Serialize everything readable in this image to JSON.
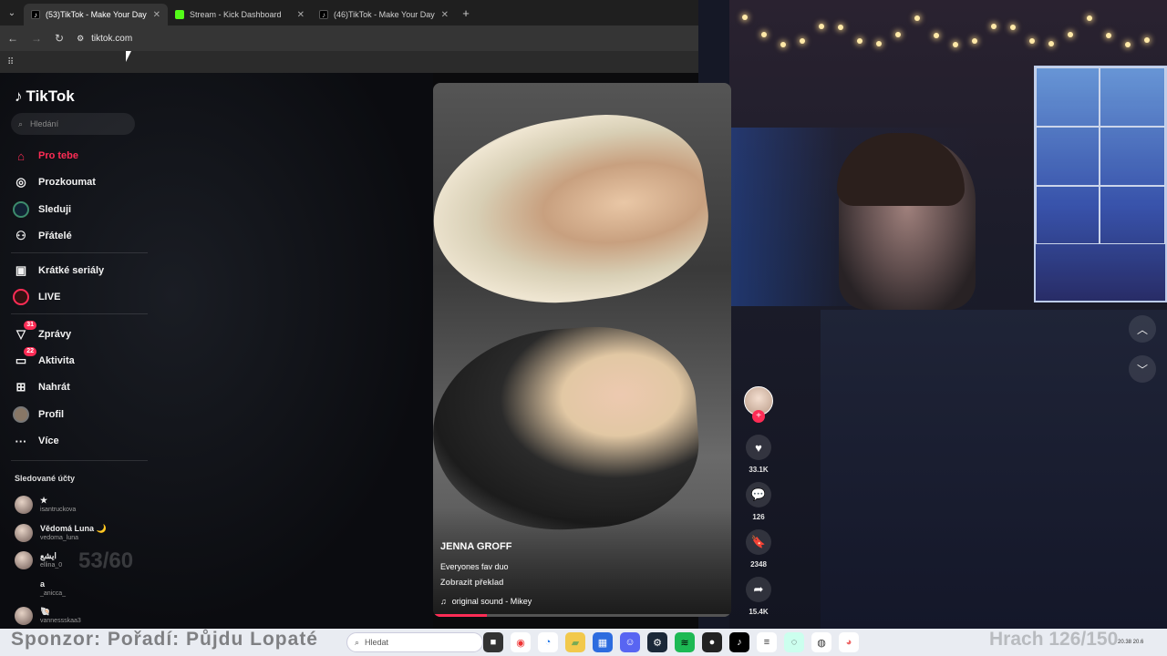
{
  "browser": {
    "tabs": [
      {
        "title": "(53)TikTok - Make Your Day",
        "active": true,
        "favicon": "tiktok-icon"
      },
      {
        "title": "Stream - Kick Dashboard",
        "active": false,
        "favicon": "kick-icon"
      },
      {
        "title": "(46)TikTok - Make Your Day",
        "active": false,
        "favicon": "tiktok-icon"
      }
    ],
    "url": "tiktok.com"
  },
  "sidebar": {
    "logo": "TikTok",
    "search_placeholder": "Hledání",
    "nav": [
      {
        "label": "Pro tebe",
        "icon": "home-icon",
        "active": true
      },
      {
        "label": "Prozkoumat",
        "icon": "compass-icon"
      },
      {
        "label": "Sleduji",
        "icon": "following-icon"
      },
      {
        "label": "Přátelé",
        "icon": "friends-icon"
      },
      {
        "label": "Krátké seriály",
        "icon": "series-icon"
      },
      {
        "label": "LIVE",
        "icon": "live-icon"
      },
      {
        "label": "Zprávy",
        "icon": "messages-icon",
        "badge": "31"
      },
      {
        "label": "Aktivita",
        "icon": "activity-icon",
        "badge": "22"
      },
      {
        "label": "Nahrát",
        "icon": "upload-icon"
      },
      {
        "label": "Profil",
        "icon": "profile-icon"
      },
      {
        "label": "Více",
        "icon": "more-icon"
      }
    ],
    "followed_title": "Sledované účty",
    "followed": [
      {
        "name": "★",
        "username": "isantruckova"
      },
      {
        "name": "Vědomá Luna 🌙",
        "username": "vedoma_luna"
      },
      {
        "name": "ايشع",
        "username": "ellina_0"
      },
      {
        "name": "a",
        "username": "_anicca_"
      },
      {
        "name": "🐚",
        "username": "vannessskaa3"
      }
    ]
  },
  "video": {
    "author": "JENNA GROFF",
    "description": "Everyones fav duo",
    "translate": "Zobrazit překlad",
    "sound": "original sound - Mikey",
    "progress": 0.18
  },
  "actions": {
    "likes": "33.1K",
    "comments": "126",
    "saves": "2348",
    "shares": "15.4K"
  },
  "overlays": {
    "fps_text": "53/60",
    "taskbar_overlay_left": "Sponzor: Pořadí: Půjdu Lopaté",
    "taskbar_overlay_right": "Hrach 126/150",
    "taskbar_search": "Hledat",
    "clock": "20.38 20.6"
  },
  "colors": {
    "accent": "#fe2c55",
    "kick_green": "#53fc18"
  }
}
